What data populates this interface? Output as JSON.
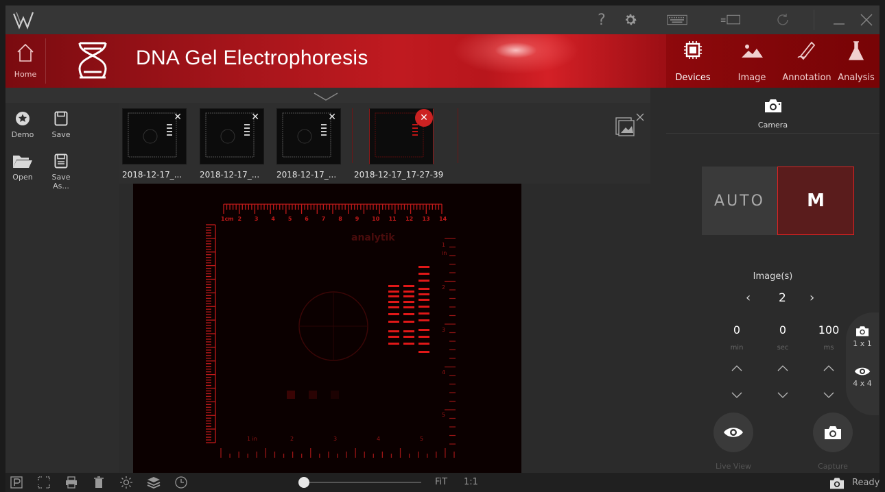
{
  "app": {
    "title": "DNA Gel Electrophoresis",
    "home_label": "Home"
  },
  "mode_tabs": [
    {
      "label": "Devices",
      "active": true
    },
    {
      "label": "Image",
      "active": false
    },
    {
      "label": "Annotation",
      "active": false
    },
    {
      "label": "Analysis",
      "active": false
    }
  ],
  "left_tools": {
    "demo": "Demo",
    "save": "Save",
    "open": "Open",
    "save_as": "Save As..."
  },
  "thumbnails": [
    {
      "label": "2018-12-17_...",
      "selected": false
    },
    {
      "label": "2018-12-17_...",
      "selected": false
    },
    {
      "label": "2018-12-17_...",
      "selected": false
    },
    {
      "label": "2018-12-17_17-27-39",
      "selected": true
    }
  ],
  "camera_panel": {
    "tab_label": "Camera",
    "auto_label": "AUTO",
    "manual_label": "M",
    "images_label": "Image(s)",
    "images_count": "2",
    "exposure": {
      "min": "0",
      "sec": "0",
      "ms": "100",
      "min_label": "min",
      "sec_label": "sec",
      "ms_label": "ms"
    },
    "live_view_label": "Live View",
    "capture_label": "Capture",
    "binning_1": "1 x 1",
    "binning_4": "4 x 4"
  },
  "bottom_bar": {
    "fit_label": "FiT",
    "one_to_one_label": "1:1",
    "status": "Ready",
    "zoom_fraction": 0.0
  },
  "gel_image": {
    "top_ruler_numbers": [
      "1cm",
      "2",
      "3",
      "4",
      "5",
      "6",
      "7",
      "8",
      "9",
      "10",
      "11",
      "12",
      "13",
      "14"
    ],
    "brand": "analytik",
    "inch_numbers": [
      "1 in",
      "2",
      "3",
      "4",
      "5"
    ],
    "right_numbers": [
      "1",
      "2",
      "3",
      "4",
      "5"
    ],
    "right_unit": "in"
  },
  "colors": {
    "accent_red": "#cc2222",
    "banner_red": "#b8161c",
    "gel_red": "#e01818"
  }
}
